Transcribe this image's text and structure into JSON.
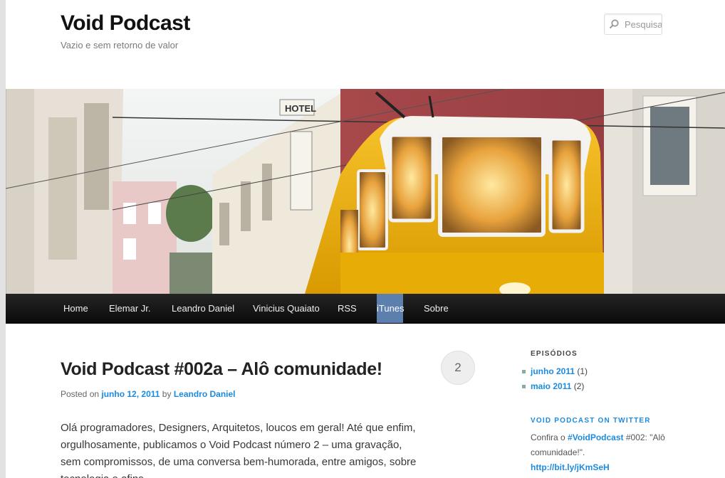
{
  "site": {
    "title": "Void Podcast",
    "description": "Vazio e sem retorno de valor"
  },
  "search": {
    "placeholder": "Pesquisar"
  },
  "header_image": {
    "description_icon": "tram-photo"
  },
  "nav": {
    "items": [
      {
        "label": "Home"
      },
      {
        "label": "Elemar Jr."
      },
      {
        "label": "Leandro Daniel"
      },
      {
        "label": "Vinicius Quaiato"
      },
      {
        "label": "RSS"
      },
      {
        "label": "iTunes"
      },
      {
        "label": "Sobre"
      }
    ],
    "active_color": "#5d7fae"
  },
  "post": {
    "title": "Void Podcast #002a – Alô comunidade!",
    "comment_count": "2",
    "meta_prefix": "Posted on",
    "date": "junho 12, 2011",
    "meta_by": "by",
    "author": "Leandro Daniel",
    "body": "Olá programadores, Designers, Arquitetos, loucos em geral! Até que enfim, orgulhosamente, publicamos o Void Podcast número 2 – uma gravação, sem compromissos, de uma conversa bem-humorada, entre amigos, sobre tecnologia e afins."
  },
  "sidebar": {
    "episodes_title": "EPISÓDIOS",
    "archives": [
      {
        "label": "junho 2011",
        "count": "(1)"
      },
      {
        "label": "maio 2011",
        "count": "(2)"
      }
    ],
    "twitter_title": "VOID PODCAST ON TWITTER",
    "tweet": {
      "prefix": "Confira o",
      "hashtag": "#VoidPodcast",
      "suffix": "#002: \"Alô comunidade!\".",
      "link": "http://bit.ly/jKmSeH"
    }
  },
  "colors": {
    "link": "#1b8be0",
    "tram_yellow": "#f2b705"
  }
}
